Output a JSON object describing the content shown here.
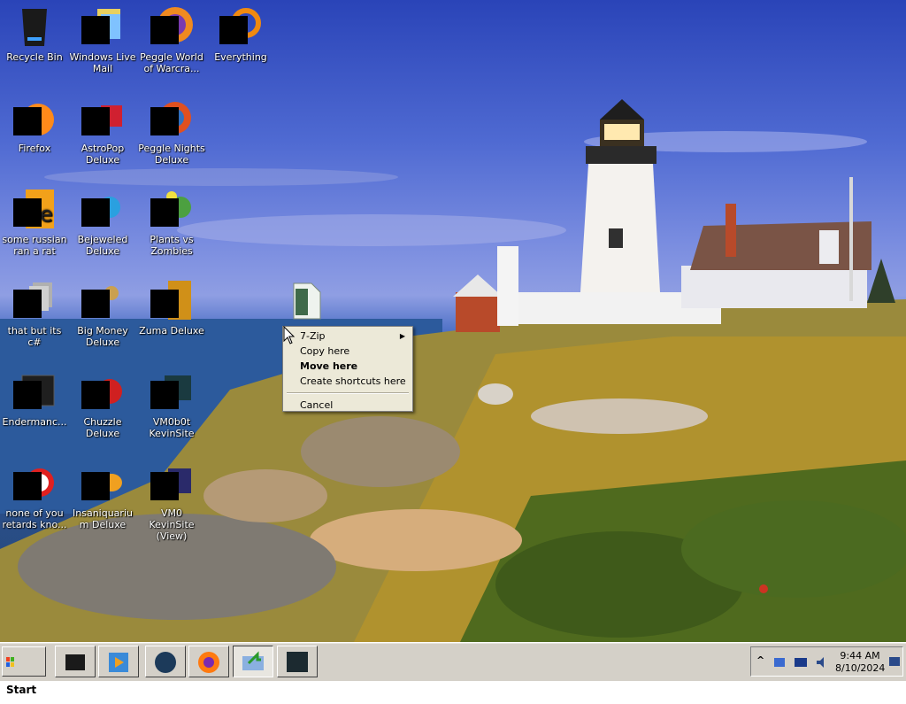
{
  "desktop": {
    "icons": [
      {
        "label": "Recycle Bin"
      },
      {
        "label": "Windows Live Mail"
      },
      {
        "label": "Peggle World of Warcra..."
      },
      {
        "label": "Everything"
      },
      {
        "label": "Firefox"
      },
      {
        "label": "AstroPop Deluxe"
      },
      {
        "label": "Peggle Nights Deluxe"
      },
      {
        "label": "some russian ran a rat"
      },
      {
        "label": "Bejeweled Deluxe"
      },
      {
        "label": "Plants vs Zombies"
      },
      {
        "label": "that but its c#"
      },
      {
        "label": "Big Money Deluxe"
      },
      {
        "label": "Zuma Deluxe"
      },
      {
        "label": "Endermanc..."
      },
      {
        "label": "Chuzzle Deluxe"
      },
      {
        "label": "VM0b0t KevinSite"
      },
      {
        "label": "none of you retards kno..."
      },
      {
        "label": "Insaniquarium Deluxe"
      },
      {
        "label": "VM0 KevinSite (View)"
      }
    ]
  },
  "context_menu": {
    "items": [
      {
        "label": "7-Zip",
        "submenu": true
      },
      {
        "label": "Copy here"
      },
      {
        "label": "Move here",
        "bold": true
      },
      {
        "label": "Create shortcuts here"
      },
      {
        "label": "Cancel"
      }
    ]
  },
  "taskbar": {
    "start_label": "Start",
    "clock_time": "9:44 AM",
    "clock_date": "8/10/2024",
    "tray_arrow": "^"
  },
  "colors": {
    "taskbar": "#d4d0c8",
    "menu": "#ece9d8",
    "sky_top": "#2a44b8",
    "grass": "#8a7a3a"
  }
}
